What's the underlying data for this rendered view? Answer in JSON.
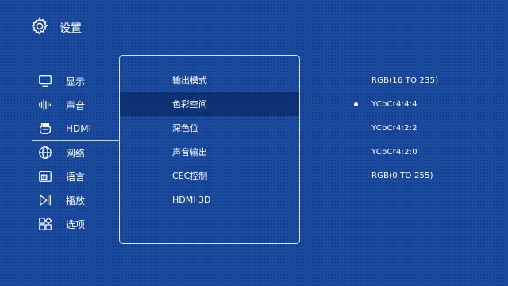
{
  "header": {
    "title": "设置",
    "icon": "gear-icon"
  },
  "sidebar": {
    "items": [
      {
        "label": "显示",
        "icon": "monitor-icon"
      },
      {
        "label": "声音",
        "icon": "sound-icon"
      },
      {
        "label": "HDMI",
        "icon": "hdmi-icon",
        "selected": true
      },
      {
        "label": "网络",
        "icon": "globe-icon"
      },
      {
        "label": "语言",
        "icon": "language-icon"
      },
      {
        "label": "播放",
        "icon": "play-pause-icon"
      },
      {
        "label": "选项",
        "icon": "options-icon"
      }
    ]
  },
  "menu": {
    "items": [
      {
        "label": "输出模式"
      },
      {
        "label": "色彩空间",
        "active": true
      },
      {
        "label": "深色位"
      },
      {
        "label": "声音输出"
      },
      {
        "label": "CEC控制"
      },
      {
        "label": "HDMI 3D"
      }
    ]
  },
  "options": {
    "items": [
      {
        "label": "RGB(16 TO 235)"
      },
      {
        "label": "YCbCr4:4:4",
        "selected": true
      },
      {
        "label": "YCbCr4:2:2"
      },
      {
        "label": "YCbCr4:2:0"
      },
      {
        "label": "RGB(0 TO 255)"
      }
    ]
  },
  "colors": {
    "background": "#1a4aa0",
    "text": "#ffffff"
  }
}
